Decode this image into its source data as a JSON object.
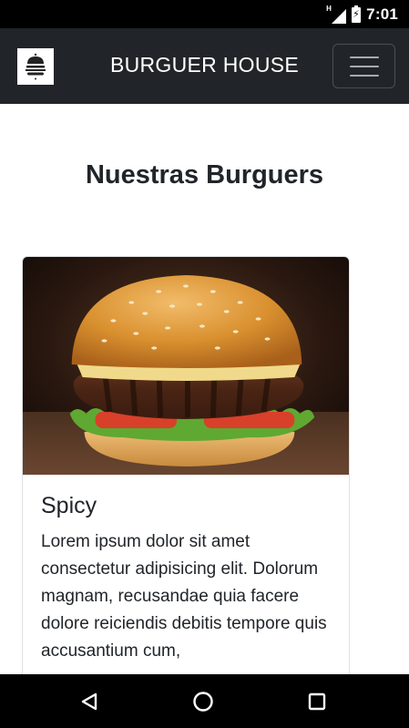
{
  "status_bar": {
    "network_badge": "H",
    "time": "7:01"
  },
  "navbar": {
    "brand_title": "BURGUER HOUSE"
  },
  "main": {
    "section_title": "Nuestras Burguers"
  },
  "card": {
    "title": "Spicy",
    "text": "Lorem ipsum dolor sit amet consectetur adipisicing elit. Dolorum magnam, recusandae quia facere dolore reiciendis debitis tempore quis accusantium cum,"
  },
  "colors": {
    "navbar_bg": "#212529",
    "status_bar_bg": "#000000",
    "text": "#212529"
  }
}
